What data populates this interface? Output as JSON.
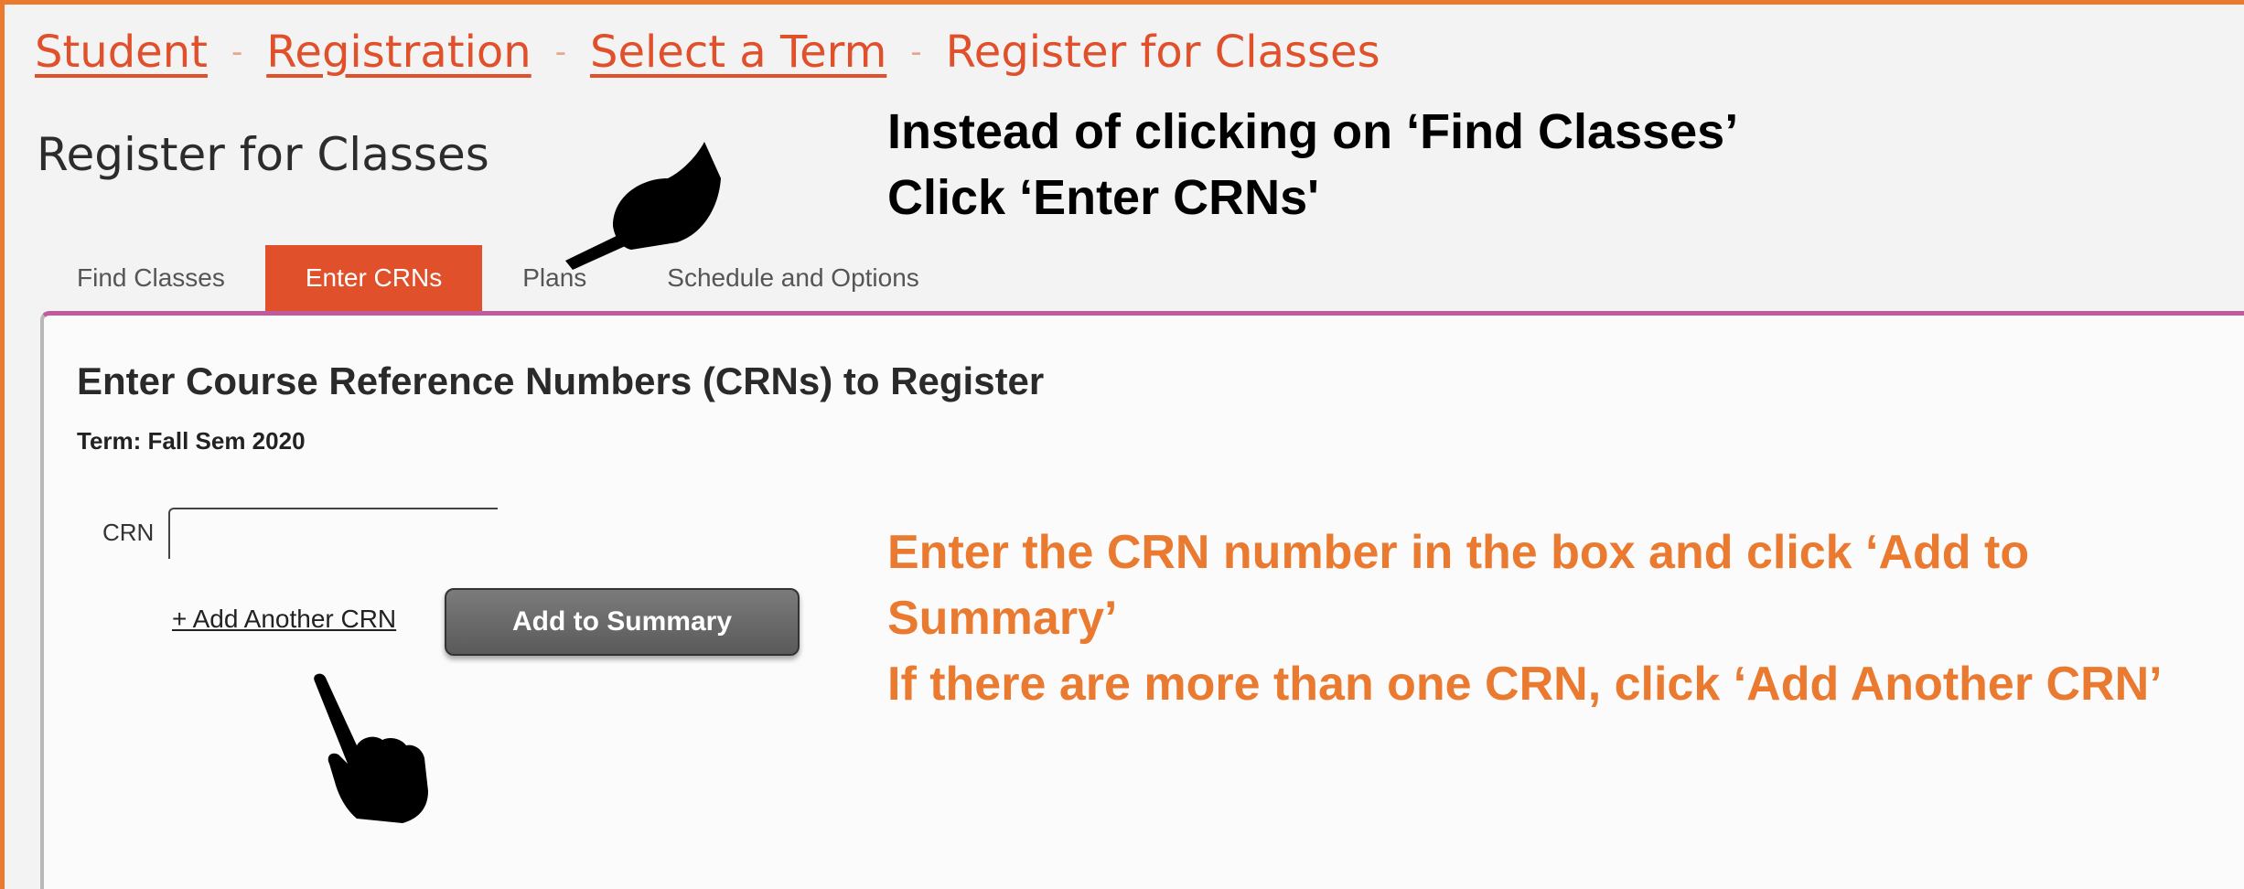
{
  "breadcrumb": {
    "items": [
      "Student",
      "Registration",
      "Select a Term"
    ],
    "current": "Register for Classes",
    "separator": "-"
  },
  "page": {
    "title": "Register for Classes"
  },
  "callouts": {
    "top": {
      "line1": "Instead of clicking on ‘Find Classes’",
      "line2": "Click ‘Enter CRNs'"
    },
    "bottom": {
      "line1": "Enter the CRN number in the box and click ‘Add to Summary’",
      "line2": "If there are more than one CRN, click ‘Add Another CRN’"
    }
  },
  "tabs": [
    {
      "label": "Find Classes",
      "active": false
    },
    {
      "label": "Enter CRNs",
      "active": true
    },
    {
      "label": "Plans",
      "active": false
    },
    {
      "label": "Schedule and Options",
      "active": false
    }
  ],
  "panel": {
    "title": "Enter Course Reference Numbers (CRNs) to Register",
    "term": "Term: Fall Sem 2020",
    "crn_label": "CRN",
    "crn_value": "",
    "add_crn_link": "+ Add Another CRN",
    "add_to_summary_button": "Add to Summary"
  },
  "icons": [
    "pointing-hand-icon",
    "pointing-hand-icon"
  ],
  "colors": {
    "accent": "#e0502a",
    "callout_orange": "#ea7a30",
    "panel_border": "#c25aa0"
  }
}
